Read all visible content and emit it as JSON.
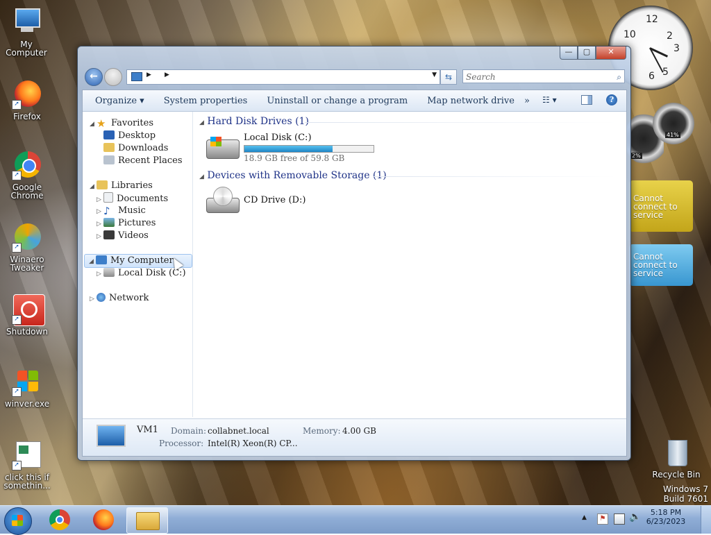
{
  "desktop": {
    "icons": [
      {
        "label": "My Computer",
        "icon": "computer-icon"
      },
      {
        "label": "Firefox",
        "icon": "firefox-icon"
      },
      {
        "label": "Google Chrome",
        "icon": "chrome-icon"
      },
      {
        "label": "Winaero Tweaker",
        "icon": "winaero-icon"
      },
      {
        "label": "Shutdown",
        "icon": "shutdown-icon"
      },
      {
        "label": "winver.exe",
        "icon": "windows-flag-icon"
      },
      {
        "label": "click this if somethin...",
        "icon": "document-icon"
      },
      {
        "label": "Recycle Bin",
        "icon": "recycle-bin-icon"
      }
    ],
    "watermark": {
      "line1": "Windows 7",
      "line2": "Build 7601"
    }
  },
  "gadgets": {
    "clock": {
      "time": "4:49"
    },
    "cpu_meter": {
      "value1": "2%",
      "value2": "41%"
    },
    "weather1": {
      "text": "Cannot connect to service"
    },
    "weather2": {
      "text": "Cannot connect to service"
    }
  },
  "window": {
    "title_buttons": {
      "minimize": "—",
      "maximize": "▢",
      "close": "✕"
    },
    "search": {
      "placeholder": "Search"
    },
    "commands": [
      "Organize ▾",
      "System properties",
      "Uninstall or change a program",
      "Map network drive",
      "»"
    ],
    "nav": {
      "favorites": "Favorites",
      "desktop": "Desktop",
      "downloads": "Downloads",
      "recent": "Recent Places",
      "libraries": "Libraries",
      "documents": "Documents",
      "music": "Music",
      "pictures": "Pictures",
      "videos": "Videos",
      "my_computer": "My Computer",
      "local_disk": "Local Disk (C:)",
      "network": "Network"
    },
    "groups": {
      "hdd": "Hard Disk Drives (1)",
      "removable": "Devices with Removable Storage (1)"
    },
    "drives": {
      "c": {
        "name": "Local Disk (C:)",
        "free": "18.9 GB free of 59.8 GB",
        "used_fraction": 0.684
      },
      "d": {
        "name": "CD Drive (D:)"
      }
    },
    "details": {
      "name": "VM1",
      "domain_label": "Domain:",
      "domain": "collabnet.local",
      "memory_label": "Memory:",
      "memory": "4.00 GB",
      "processor_label": "Processor:",
      "processor": "Intel(R) Xeon(R) CP..."
    }
  },
  "taskbar": {
    "pinned": [
      "chrome-icon",
      "firefox-icon",
      "explorer-icon"
    ],
    "time": "5:18 PM",
    "date": "6/23/2023"
  },
  "colors": {
    "accent": "#1f86c7",
    "group_heading": "#1e3287"
  }
}
